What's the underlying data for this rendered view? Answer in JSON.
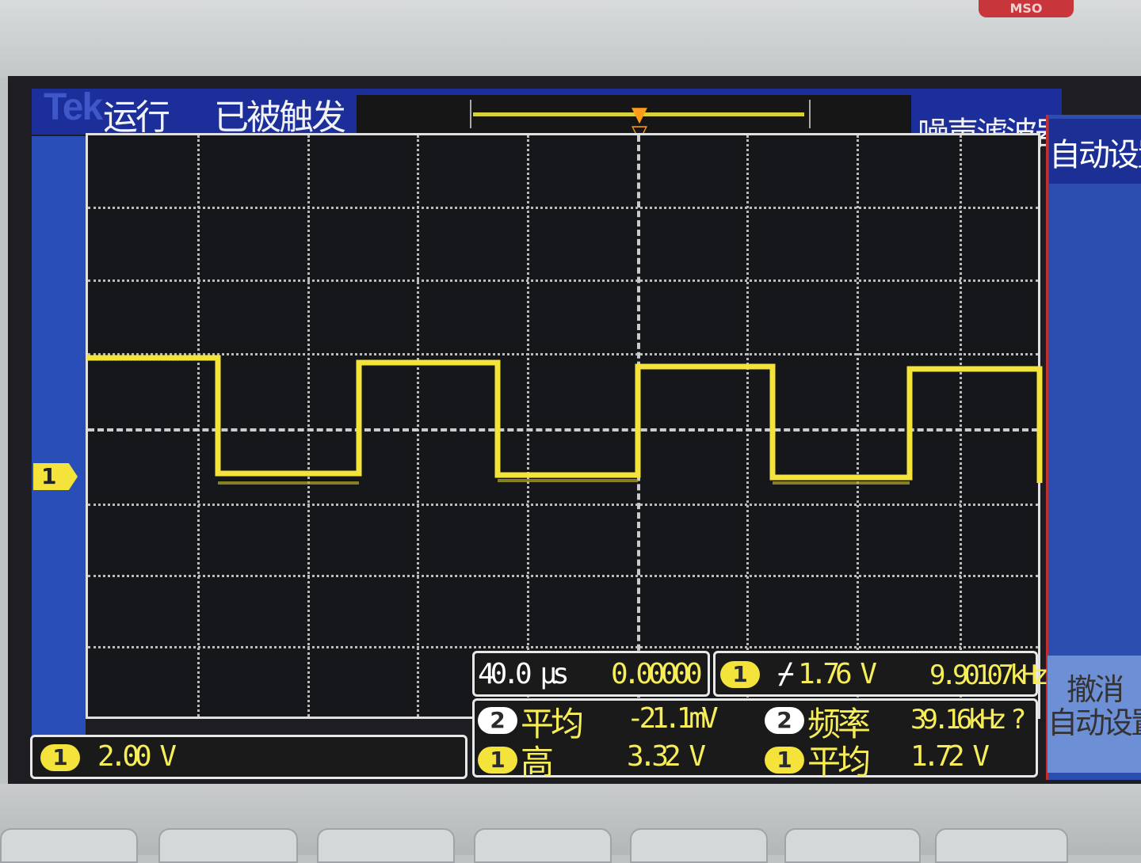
{
  "header": {
    "logo": "Tek",
    "run_state": "运行",
    "trigger_state": "已被触发",
    "filter_label": "噪声滤波器",
    "badge": "MSO"
  },
  "side_menu": {
    "top_item": "自动设置",
    "bottom_item_line1": "撤消",
    "bottom_item_line2": "自动设置"
  },
  "channel_marker": "1",
  "channel_scale": {
    "channel": "1",
    "value": "2.00 V"
  },
  "timebase": {
    "scale": "40.0 μs",
    "position": "0.00000 s"
  },
  "trigger": {
    "channel": "1",
    "slope_symbol": "⌿",
    "level": "1.76 V",
    "frequency": "9.90107kHz"
  },
  "measurements": [
    {
      "channel": "2",
      "label": "平均",
      "value": "-21.1mV"
    },
    {
      "channel": "1",
      "label": "高",
      "value": "3.32 V"
    },
    {
      "channel": "2",
      "label": "频率",
      "value": "39.16kHz",
      "flag": "?"
    },
    {
      "channel": "1",
      "label": "平均",
      "value": "1.72 V"
    }
  ],
  "colors": {
    "trace": "#f3e33a",
    "trigger_marker": "#ff9d1a",
    "top_bar": "#1c2e9a",
    "side_panel": "#2c4eb0"
  },
  "waveform": {
    "type": "square",
    "frequency_khz": 9.90107,
    "high_level_v": 3.32,
    "mean_v": 1.72
  }
}
